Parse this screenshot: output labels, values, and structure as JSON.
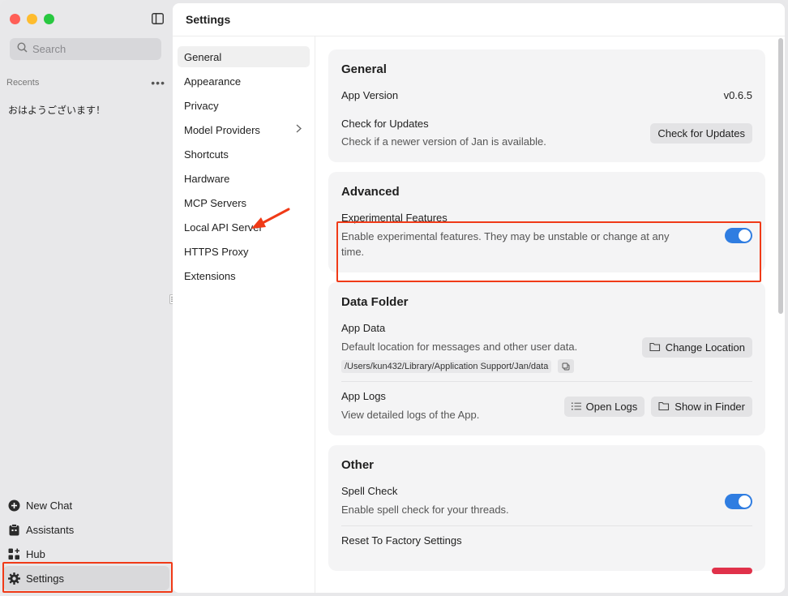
{
  "sidebar": {
    "search_placeholder": "Search",
    "recents_label": "Recents",
    "recents_more": "•••",
    "recent_items": [
      "おはようございます！"
    ],
    "nav": [
      {
        "label": "New Chat",
        "icon": "plus-circle-icon"
      },
      {
        "label": "Assistants",
        "icon": "clipboard-icon"
      },
      {
        "label": "Hub",
        "icon": "grid-plus-icon"
      },
      {
        "label": "Settings",
        "icon": "gear-icon"
      }
    ],
    "active_nav": "Settings"
  },
  "header": {
    "title": "Settings"
  },
  "subnav": {
    "items": [
      {
        "label": "General"
      },
      {
        "label": "Appearance"
      },
      {
        "label": "Privacy"
      },
      {
        "label": "Model Providers"
      },
      {
        "label": "Shortcuts"
      },
      {
        "label": "Hardware"
      },
      {
        "label": "MCP Servers"
      },
      {
        "label": "Local API Server"
      },
      {
        "label": "HTTPS Proxy"
      },
      {
        "label": "Extensions"
      }
    ],
    "active": "General"
  },
  "general": {
    "title": "General",
    "app_version_label": "App Version",
    "app_version_value": "v0.6.5",
    "updates_title": "Check for Updates",
    "updates_desc": "Check if a newer version of Jan is available.",
    "updates_button": "Check for Updates"
  },
  "advanced": {
    "title": "Advanced",
    "experimental_title": "Experimental Features",
    "experimental_desc": "Enable experimental features. They may be unstable or change at any time.",
    "experimental_enabled": true
  },
  "data_folder": {
    "title": "Data Folder",
    "app_data_title": "App Data",
    "app_data_desc": "Default location for messages and other user data.",
    "app_data_path": "/Users/kun432/Library/Application Support/Jan/data",
    "change_location_button": "Change Location",
    "app_logs_title": "App Logs",
    "app_logs_desc": "View detailed logs of the App.",
    "open_logs_button": "Open Logs",
    "show_in_finder_button": "Show in Finder"
  },
  "other": {
    "title": "Other",
    "spell_check_title": "Spell Check",
    "spell_check_desc": "Enable spell check for your threads.",
    "spell_check_enabled": true,
    "reset_title": "Reset To Factory Settings"
  },
  "colors": {
    "accent": "#2f7de1",
    "annotation": "#f03a17"
  }
}
